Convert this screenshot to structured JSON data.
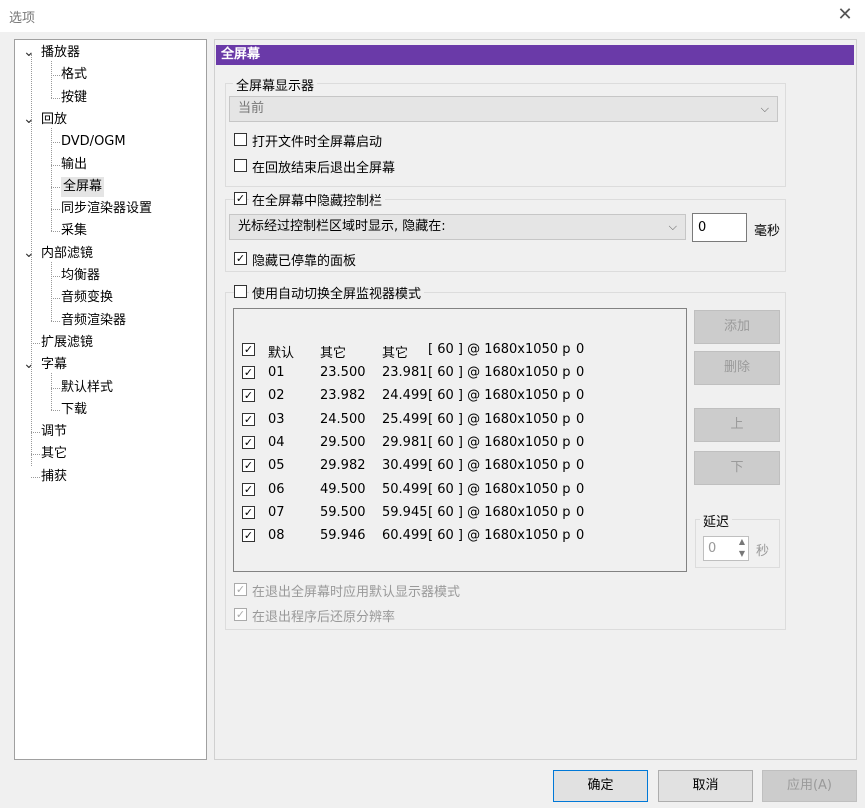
{
  "window": {
    "title": "选项",
    "close_glyph": "✕"
  },
  "tree": {
    "items": [
      {
        "label": "播放器",
        "level": 0,
        "expanded": true
      },
      {
        "label": "格式",
        "level": 1
      },
      {
        "label": "按键",
        "level": 1
      },
      {
        "label": "回放",
        "level": 0,
        "expanded": true
      },
      {
        "label": "DVD/OGM",
        "level": 1
      },
      {
        "label": "输出",
        "level": 1
      },
      {
        "label": "全屏幕",
        "level": 1,
        "selected": true
      },
      {
        "label": "同步渲染器设置",
        "level": 1
      },
      {
        "label": "采集",
        "level": 1
      },
      {
        "label": "内部滤镜",
        "level": 0,
        "expanded": true
      },
      {
        "label": "均衡器",
        "level": 1
      },
      {
        "label": "音频变换",
        "level": 1
      },
      {
        "label": "音频渲染器",
        "level": 1
      },
      {
        "label": "扩展滤镜",
        "level": 0
      },
      {
        "label": "字幕",
        "level": 0,
        "expanded": true
      },
      {
        "label": "默认样式",
        "level": 1
      },
      {
        "label": "下载",
        "level": 1
      },
      {
        "label": "调节",
        "level": 0
      },
      {
        "label": "其它",
        "level": 0
      },
      {
        "label": "捕获",
        "level": 0
      }
    ]
  },
  "page": {
    "header": "全屏幕"
  },
  "monitor": {
    "group_label": "全屏幕显示器",
    "selected": "当前"
  },
  "launch_fullscreen": {
    "label": "打开文件时全屏幕启动",
    "checked": false
  },
  "exit_on_end": {
    "label": "在回放结束后退出全屏幕",
    "checked": false
  },
  "hide_controls": {
    "label": "在全屏幕中隐藏控制栏",
    "checked": true,
    "mode": "光标经过控制栏区域时显示, 隐藏在:",
    "delay_value": "0",
    "delay_unit": "毫秒",
    "hide_docked": {
      "label": "隐藏已停靠的面板",
      "checked": true
    }
  },
  "auto_switch": {
    "label": "使用自动切换全屏监视器模式",
    "checked": false,
    "columns": [
      "默认",
      "其它",
      "其它",
      "[ 60 ] @ 1680x1050 p",
      "0"
    ],
    "rows": [
      {
        "id": "01",
        "from": "23.500",
        "to": "23.981",
        "mode": "[ 60 ] @ 1680x1050 p",
        "val": "0"
      },
      {
        "id": "02",
        "from": "23.982",
        "to": "24.499",
        "mode": "[ 60 ] @ 1680x1050 p",
        "val": "0"
      },
      {
        "id": "03",
        "from": "24.500",
        "to": "25.499",
        "mode": "[ 60 ] @ 1680x1050 p",
        "val": "0"
      },
      {
        "id": "04",
        "from": "29.500",
        "to": "29.981",
        "mode": "[ 60 ] @ 1680x1050 p",
        "val": "0"
      },
      {
        "id": "05",
        "from": "29.982",
        "to": "30.499",
        "mode": "[ 60 ] @ 1680x1050 p",
        "val": "0"
      },
      {
        "id": "06",
        "from": "49.500",
        "to": "50.499",
        "mode": "[ 60 ] @ 1680x1050 p",
        "val": "0"
      },
      {
        "id": "07",
        "from": "59.500",
        "to": "59.945",
        "mode": "[ 60 ] @ 1680x1050 p",
        "val": "0"
      },
      {
        "id": "08",
        "from": "59.946",
        "to": "60.499",
        "mode": "[ 60 ] @ 1680x1050 p",
        "val": "0"
      }
    ],
    "buttons": {
      "add": "添加",
      "remove": "删除",
      "up": "上",
      "down": "下"
    },
    "delay": {
      "label": "延迟",
      "value": "0",
      "unit": "秒"
    },
    "restore_default": {
      "label": "在退出全屏幕时应用默认显示器模式",
      "checked": true
    },
    "restore_resolution": {
      "label": "在退出程序后还原分辨率",
      "checked": true
    }
  },
  "footer": {
    "ok": "确定",
    "cancel": "取消",
    "apply": "应用(A)"
  }
}
